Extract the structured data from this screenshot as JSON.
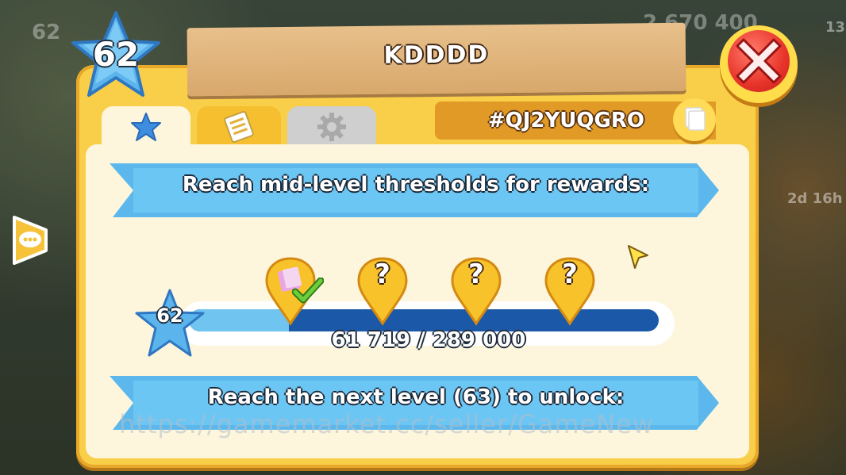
{
  "player": {
    "level": "62",
    "name": "KDDDD",
    "tag": "#QJ2YUQGRO"
  },
  "background": {
    "level_badge": "62",
    "coins": "2 670 400",
    "timer": "2d 16h",
    "counter": "13"
  },
  "tabs": [
    {
      "icon": "star-icon",
      "active": true
    },
    {
      "icon": "notes-icon",
      "active": false
    },
    {
      "icon": "gear-icon",
      "active": false
    }
  ],
  "rewards": {
    "heading": "Reach mid-level thresholds for rewards:",
    "markers": [
      {
        "state": "claimed",
        "label": ""
      },
      {
        "state": "locked",
        "label": "?"
      },
      {
        "state": "locked",
        "label": "?"
      },
      {
        "state": "locked",
        "label": "?"
      }
    ],
    "progress": {
      "level": "62",
      "label": "61 719 / 289 000",
      "fraction": 0.2136
    }
  },
  "next_level": {
    "text": "Reach the next level (63) to unlock:"
  },
  "watermark": "https://gamemarket.cc/seller/GameNew",
  "colors": {
    "panel": "#f9cf4a",
    "ribbon": "#5cb8ec",
    "close": "#e8342a",
    "progress_fill": "#6fc4f0"
  }
}
